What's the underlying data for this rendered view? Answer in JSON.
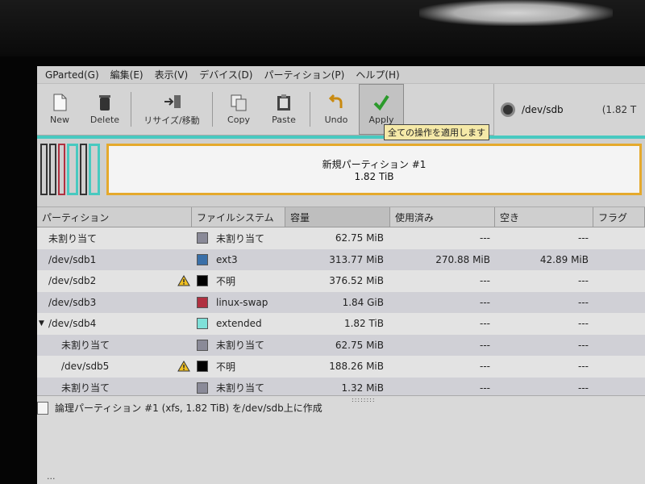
{
  "menu": [
    "GParted(G)",
    "編集(E)",
    "表示(V)",
    "デバイス(D)",
    "パーティション(P)",
    "ヘルプ(H)"
  ],
  "toolbar": {
    "new": "New",
    "delete": "Delete",
    "resize": "リサイズ/移動",
    "copy": "Copy",
    "paste": "Paste",
    "undo": "Undo",
    "apply": "Apply"
  },
  "tooltip": "全ての操作を適用します",
  "device": {
    "name": "/dev/sdb",
    "size": "(1.82 T"
  },
  "map": {
    "label": "新規パーティション #1",
    "size": "1.82 TiB"
  },
  "columns": [
    "パーティション",
    "ファイルシステム",
    "容量",
    "使用済み",
    "空き",
    "フラグ"
  ],
  "rows": [
    {
      "part": "未割り当て",
      "fs": "未割り当て",
      "size": "62.75 MiB",
      "used": "---",
      "free": "---"
    },
    {
      "part": "/dev/sdb1",
      "fs": "ext3",
      "size": "313.77 MiB",
      "used": "270.88 MiB",
      "free": "42.89 MiB"
    },
    {
      "part": "/dev/sdb2",
      "fs": "不明",
      "size": "376.52 MiB",
      "used": "---",
      "free": "---"
    },
    {
      "part": "/dev/sdb3",
      "fs": "linux-swap",
      "size": "1.84 GiB",
      "used": "---",
      "free": "---"
    },
    {
      "part": "/dev/sdb4",
      "fs": "extended",
      "size": "1.82 TiB",
      "used": "---",
      "free": "---"
    },
    {
      "part": "未割り当て",
      "fs": "未割り当て",
      "size": "62.75 MiB",
      "used": "---",
      "free": "---"
    },
    {
      "part": "/dev/sdb5",
      "fs": "不明",
      "size": "188.26 MiB",
      "used": "---",
      "free": "---"
    },
    {
      "part": "未割り当て",
      "fs": "未割り当て",
      "size": "1.32 MiB",
      "used": "---",
      "free": "---"
    }
  ],
  "colors": {
    "unallocated": "#8a8a98",
    "ext3": "#3a6fa8",
    "unknown": "#000000",
    "swap": "#b03040",
    "extended": "#7fe0d8",
    "accent_cyan": "#48c9c0",
    "new_partition": "#e5a92c"
  },
  "operation": "論理パーティション #1 (xfs, 1.82 TiB) を/dev/sdb上に作成",
  "status": "..."
}
